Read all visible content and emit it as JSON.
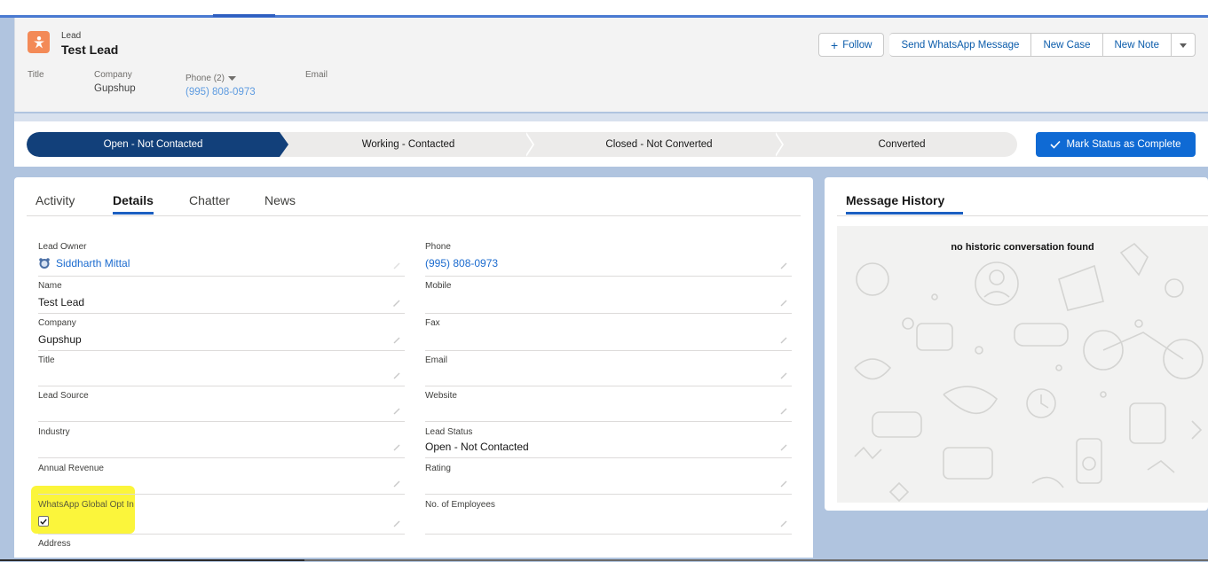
{
  "header": {
    "object_type": "Lead",
    "record_name": "Test Lead",
    "object_icon": "lead-person-icon",
    "buttons": {
      "follow": "Follow",
      "send_whatsapp": "Send WhatsApp Message",
      "new_case": "New Case",
      "new_note": "New Note"
    },
    "highlights": {
      "title_label": "Title",
      "company_label": "Company",
      "company_value": "Gupshup",
      "phone_label": "Phone (2)",
      "phone_value": "(995) 808-0973",
      "email_label": "Email"
    }
  },
  "path": {
    "stages": [
      "Open - Not Contacted",
      "Working - Contacted",
      "Closed - Not Converted",
      "Converted"
    ],
    "current_stage": "Open - Not Contacted",
    "complete_button": "Mark Status as Complete",
    "accent_color": "#12407a"
  },
  "tabs": {
    "activity": "Activity",
    "details": "Details",
    "chatter": "Chatter",
    "news": "News",
    "active": "Details"
  },
  "fields": {
    "lead_owner": {
      "label": "Lead Owner",
      "value": "Siddharth Mittal"
    },
    "phone": {
      "label": "Phone",
      "value": "(995) 808-0973"
    },
    "name": {
      "label": "Name",
      "value": "Test Lead"
    },
    "mobile": {
      "label": "Mobile",
      "value": ""
    },
    "company": {
      "label": "Company",
      "value": "Gupshup"
    },
    "fax": {
      "label": "Fax",
      "value": ""
    },
    "title": {
      "label": "Title",
      "value": ""
    },
    "email": {
      "label": "Email",
      "value": ""
    },
    "lead_source": {
      "label": "Lead Source",
      "value": ""
    },
    "website": {
      "label": "Website",
      "value": ""
    },
    "industry": {
      "label": "Industry",
      "value": ""
    },
    "lead_status": {
      "label": "Lead Status",
      "value": "Open - Not Contacted"
    },
    "annual_revenue": {
      "label": "Annual Revenue",
      "value": ""
    },
    "rating": {
      "label": "Rating",
      "value": ""
    },
    "whatsapp_opt_in": {
      "label": "WhatsApp Global Opt In",
      "checked": true
    },
    "employees": {
      "label": "No. of Employees",
      "value": ""
    },
    "address": {
      "label": "Address",
      "value": ""
    }
  },
  "message_history": {
    "title": "Message History",
    "empty_text": "no historic conversation found"
  },
  "colors": {
    "brand_blue": "#0f6ad4",
    "link_blue": "#1b6bcf",
    "highlight_yellow": "#fbf53b",
    "lead_icon": "#f38a57"
  }
}
